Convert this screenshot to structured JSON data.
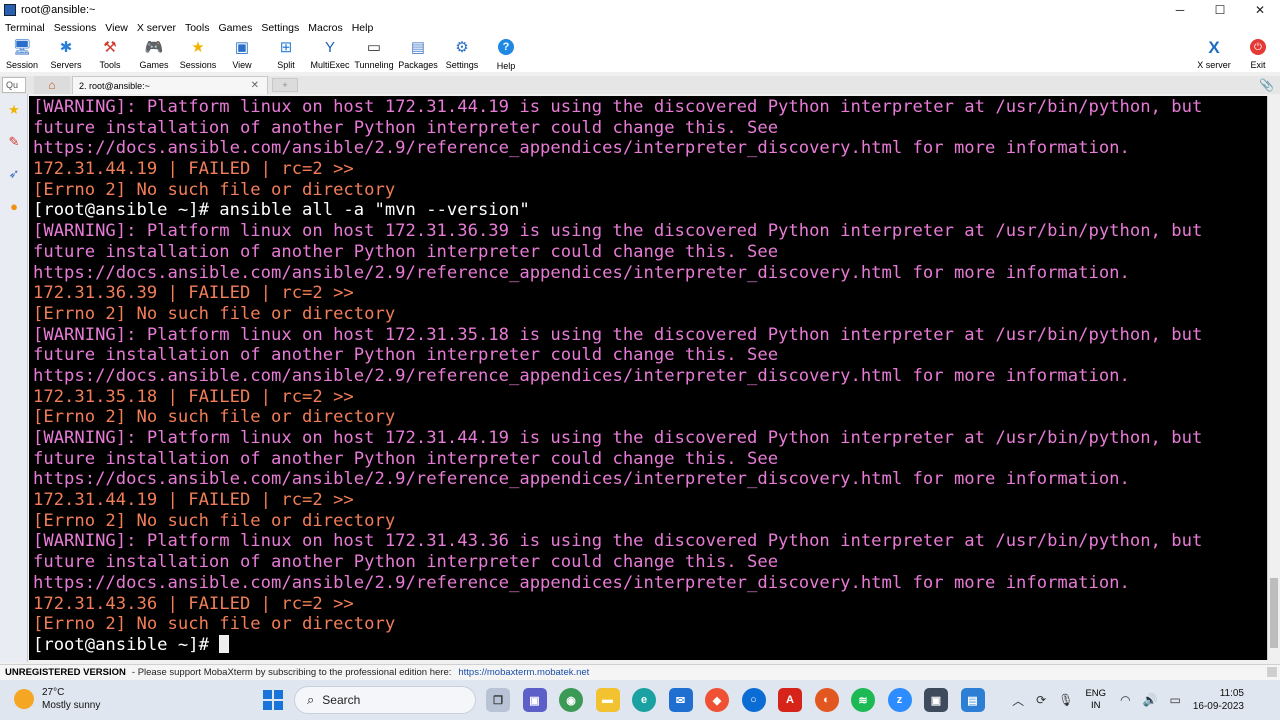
{
  "window": {
    "title": "root@ansible:~",
    "controls": [
      "─",
      "☐",
      "✕"
    ]
  },
  "menu": [
    "Terminal",
    "Sessions",
    "View",
    "X server",
    "Tools",
    "Games",
    "Settings",
    "Macros",
    "Help"
  ],
  "toolbar": {
    "items": [
      {
        "label": "Session",
        "icon": "session-icon"
      },
      {
        "label": "Servers",
        "icon": "servers-icon"
      },
      {
        "label": "Tools",
        "icon": "tools-icon"
      },
      {
        "label": "Games",
        "icon": "games-icon"
      },
      {
        "label": "Sessions",
        "icon": "star-icon"
      },
      {
        "label": "View",
        "icon": "view-icon"
      },
      {
        "label": "Split",
        "icon": "split-icon"
      },
      {
        "label": "MultiExec",
        "icon": "multiexec-icon"
      },
      {
        "label": "Tunneling",
        "icon": "tunneling-icon"
      },
      {
        "label": "Packages",
        "icon": "packages-icon"
      },
      {
        "label": "Settings",
        "icon": "gear-icon"
      },
      {
        "label": "Help",
        "icon": "help-icon"
      }
    ],
    "xserver_label": "X server",
    "exit_label": "Exit"
  },
  "tabs": {
    "quick_connect_placeholder": "Qu",
    "active_tab_label": "2. root@ansible:~"
  },
  "terminal": {
    "lines": [
      {
        "type": "warn",
        "text": "[WARNING]: Platform linux on host 172.31.44.19 is using the discovered Python interpreter at /usr/bin/python, but"
      },
      {
        "type": "warn",
        "text": "future installation of another Python interpreter could change this. See"
      },
      {
        "type": "warn",
        "text": "https://docs.ansible.com/ansible/2.9/reference_appendices/interpreter_discovery.html for more information."
      },
      {
        "type": "fail",
        "text": "172.31.44.19 | FAILED | rc=2 >>"
      },
      {
        "type": "err",
        "text": "[Errno 2] No such file or directory"
      },
      {
        "type": "cmd",
        "text": "[root@ansible ~]# ansible all -a \"mvn --version\""
      },
      {
        "type": "warn",
        "text": "[WARNING]: Platform linux on host 172.31.36.39 is using the discovered Python interpreter at /usr/bin/python, but"
      },
      {
        "type": "warn",
        "text": "future installation of another Python interpreter could change this. See"
      },
      {
        "type": "warn",
        "text": "https://docs.ansible.com/ansible/2.9/reference_appendices/interpreter_discovery.html for more information."
      },
      {
        "type": "fail",
        "text": "172.31.36.39 | FAILED | rc=2 >>"
      },
      {
        "type": "err",
        "text": "[Errno 2] No such file or directory"
      },
      {
        "type": "warn",
        "text": "[WARNING]: Platform linux on host 172.31.35.18 is using the discovered Python interpreter at /usr/bin/python, but"
      },
      {
        "type": "warn",
        "text": "future installation of another Python interpreter could change this. See"
      },
      {
        "type": "warn",
        "text": "https://docs.ansible.com/ansible/2.9/reference_appendices/interpreter_discovery.html for more information."
      },
      {
        "type": "fail",
        "text": "172.31.35.18 | FAILED | rc=2 >>"
      },
      {
        "type": "err",
        "text": "[Errno 2] No such file or directory"
      },
      {
        "type": "warn",
        "text": "[WARNING]: Platform linux on host 172.31.44.19 is using the discovered Python interpreter at /usr/bin/python, but"
      },
      {
        "type": "warn",
        "text": "future installation of another Python interpreter could change this. See"
      },
      {
        "type": "warn",
        "text": "https://docs.ansible.com/ansible/2.9/reference_appendices/interpreter_discovery.html for more information."
      },
      {
        "type": "fail",
        "text": "172.31.44.19 | FAILED | rc=2 >>"
      },
      {
        "type": "err",
        "text": "[Errno 2] No such file or directory"
      },
      {
        "type": "warn",
        "text": "[WARNING]: Platform linux on host 172.31.43.36 is using the discovered Python interpreter at /usr/bin/python, but"
      },
      {
        "type": "warn",
        "text": "future installation of another Python interpreter could change this. See"
      },
      {
        "type": "warn",
        "text": "https://docs.ansible.com/ansible/2.9/reference_appendices/interpreter_discovery.html for more information."
      },
      {
        "type": "fail",
        "text": "172.31.43.36 | FAILED | rc=2 >>"
      },
      {
        "type": "err",
        "text": "[Errno 2] No such file or directory"
      }
    ],
    "prompt": "[root@ansible ~]# ",
    "colors": {
      "warning": "#e77bd6",
      "failed": "#f27d58",
      "prompt": "#ffffff",
      "background": "#000000"
    }
  },
  "statusbar": {
    "unregistered": "UNREGISTERED VERSION",
    "message": "-  Please support MobaXterm by subscribing to the professional edition here:",
    "link": "https://mobaxterm.mobatek.net"
  },
  "taskbar": {
    "weather_temp": "27°C",
    "weather_desc": "Mostly sunny",
    "search_label": "Search",
    "lang_top": "ENG",
    "lang_bottom": "IN",
    "time": "11:05",
    "date": "16-09-2023"
  }
}
